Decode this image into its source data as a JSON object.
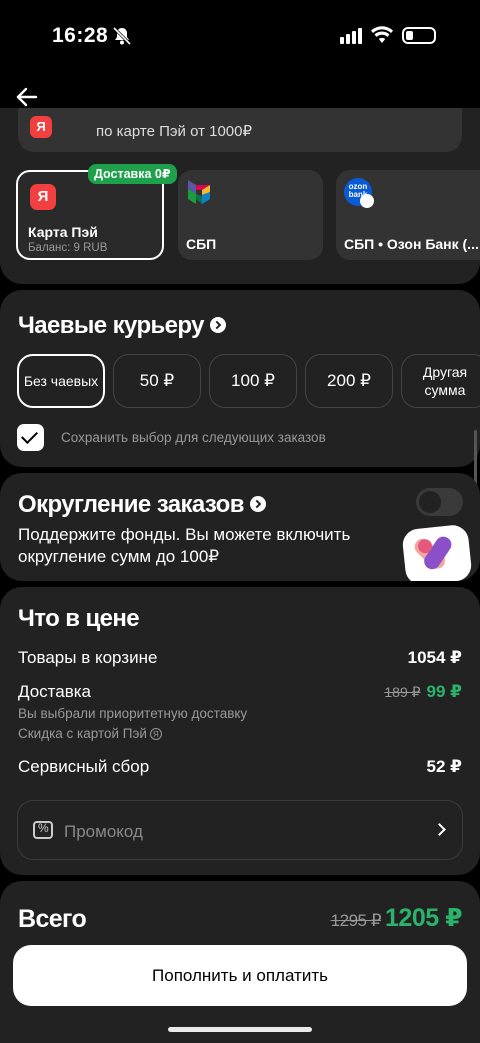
{
  "status_bar": {
    "time": "16:28",
    "battery_level": 0.25
  },
  "promo_strip": {
    "text": "по карте Пэй от 1000₽",
    "logo": "Я"
  },
  "payment_methods": [
    {
      "title": "Карта Пэй",
      "subtitle": "Баланс: 9 RUB",
      "badge": "Доставка 0₽",
      "logo": "Я",
      "selected": true
    },
    {
      "title": "СБП",
      "selected": false
    },
    {
      "title": "СБП • Озон Банк (...",
      "logo": "ozon bank",
      "selected": false
    }
  ],
  "tips": {
    "title": "Чаевые курьеру",
    "options": [
      "Без чаевых",
      "50 ₽",
      "100 ₽",
      "200 ₽",
      "Другая сумма"
    ],
    "selected_index": 0,
    "save_choice_label": "Сохранить выбор для следующих заказов",
    "save_choice_checked": true
  },
  "rounding": {
    "title": "Округление заказов",
    "description": "Поддержите фонды. Вы можете включить округление сумм до 100₽",
    "enabled": false
  },
  "price": {
    "title": "Что в цене",
    "goods_label": "Товары в корзине",
    "goods_value": "1054 ₽",
    "delivery_label": "Доставка",
    "delivery_old": "189 ₽",
    "delivery_new": "99 ₽",
    "delivery_note": "Вы выбрали приоритетную доставку",
    "discount_note": "Скидка с картой Пэй",
    "discount_badge": "Я",
    "service_label": "Сервисный сбор",
    "service_value": "52 ₽",
    "promo_placeholder": "Промокод"
  },
  "total": {
    "title": "Всего",
    "old": "1295 ₽",
    "new": "1205 ₽"
  },
  "pay_button": "Пополнить и оплатить",
  "colors": {
    "accent_green": "#2bb36b",
    "badge_green": "#1ea14a",
    "yandex_red": "#f23f3f",
    "ozon_blue": "#0a5ad6"
  }
}
